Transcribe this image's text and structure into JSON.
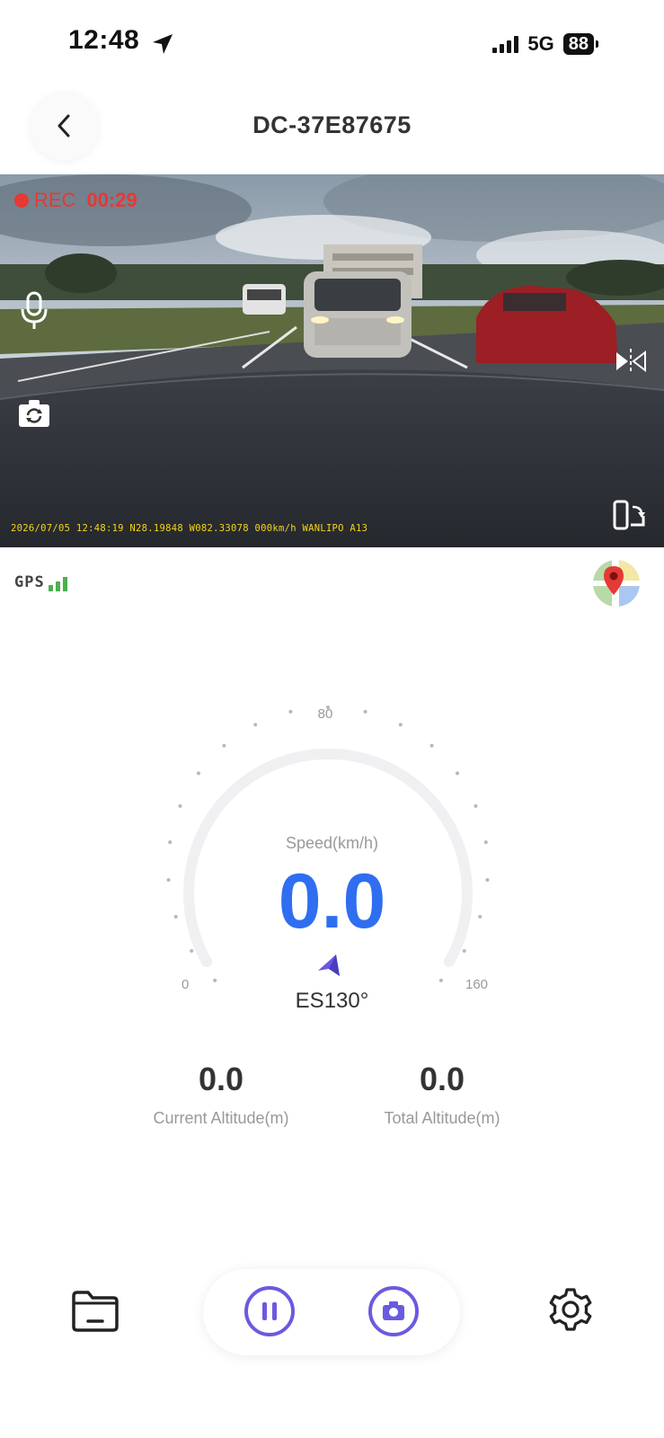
{
  "status_bar": {
    "time": "12:48",
    "network": "5G",
    "battery": "88"
  },
  "header": {
    "title": "DC-37E87675"
  },
  "video": {
    "rec_label": "REC",
    "rec_time": "00:29",
    "overlay_text": "2026/07/05 12:48:19  N28.19848 W082.33078 000km/h WANLIPO A13"
  },
  "gps": {
    "label": "GPS"
  },
  "gauge": {
    "min_label": "0",
    "mid_label": "80",
    "max_label": "160",
    "speed_label": "Speed(km/h)",
    "speed_value": "0.0",
    "heading": "ES130°"
  },
  "altitude": {
    "current_value": "0.0",
    "current_label": "Current Altitude(m)",
    "total_value": "0.0",
    "total_label": "Total Altitude(m)"
  },
  "colors": {
    "accent": "#2f6ef0",
    "rec_red": "#e53935",
    "button_purple": "#6a5ae0",
    "overlay_yellow": "#f4d51a"
  },
  "icons": {
    "back": "chevron-left-icon",
    "mic": "microphone-icon",
    "camera_switch": "camera-switch-icon",
    "mirror": "flip-horizontal-icon",
    "fullscreen": "rotate-fullscreen-icon",
    "map": "map-pin-icon",
    "folder": "folder-icon",
    "pause": "pause-icon",
    "photo": "camera-icon",
    "settings": "gear-icon"
  }
}
